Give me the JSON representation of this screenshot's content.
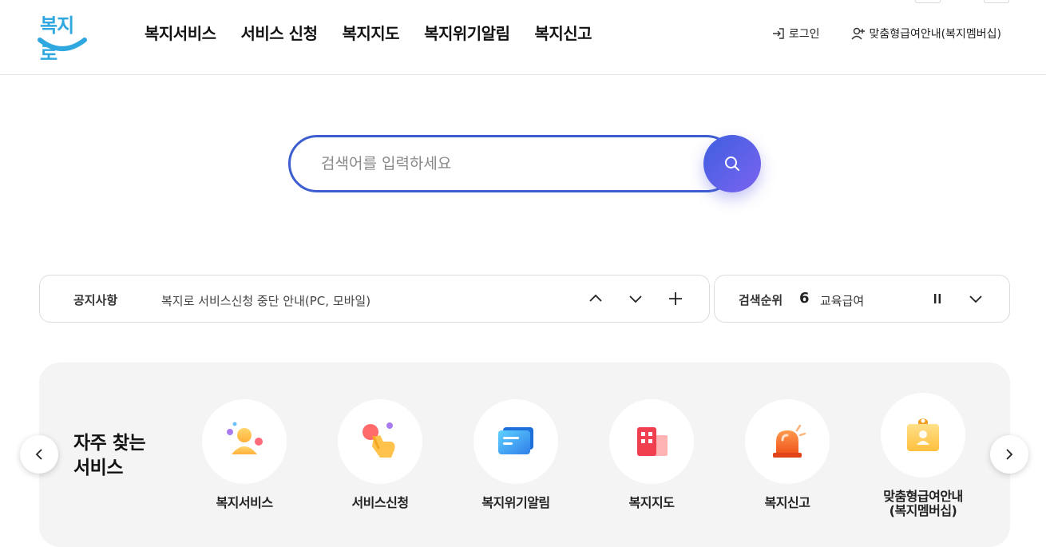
{
  "header": {
    "logo_text": "복지로",
    "nav": [
      "복지서비스",
      "서비스 신청",
      "복지지도",
      "복지위기알림",
      "복지신고"
    ],
    "login_label": "로그인",
    "membership_label": "맞춤형급여안내(복지멤버십)"
  },
  "search": {
    "placeholder": "검색어를 입력하세요"
  },
  "notice": {
    "label": "공지사항",
    "text": "복지로 서비스신청 중단 안내(PC, 모바일)"
  },
  "rank": {
    "label": "검색순위",
    "number": "6",
    "keyword": "교육급여"
  },
  "frequent": {
    "title": "자주 찾는\n서비스",
    "items": [
      {
        "label": "복지서비스",
        "icon": "person-icon"
      },
      {
        "label": "서비스신청",
        "icon": "hand-pointer-icon"
      },
      {
        "label": "복지위기알림",
        "icon": "message-icon"
      },
      {
        "label": "복지지도",
        "icon": "building-icon"
      },
      {
        "label": "복지신고",
        "icon": "siren-icon"
      },
      {
        "label": "맞춤형급여안내\n(복지멤버십)",
        "icon": "id-card-icon"
      }
    ]
  },
  "colors": {
    "brand_blue": "#3d5ecf",
    "logo_blue": "#2fa8e0",
    "search_gradient_end": "#7b63f0"
  }
}
